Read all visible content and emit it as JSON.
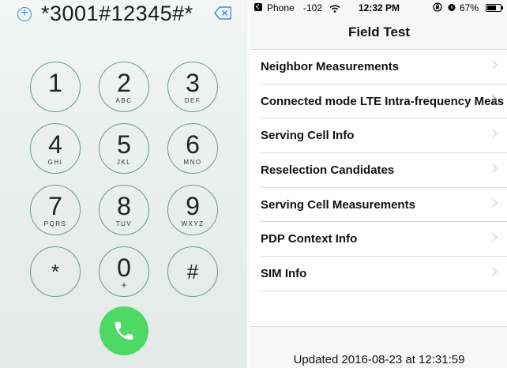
{
  "dialer": {
    "dialed_number": "*3001#12345#*",
    "keys": [
      {
        "digit": "1",
        "letters": ""
      },
      {
        "digit": "2",
        "letters": "ABC"
      },
      {
        "digit": "3",
        "letters": "DEF"
      },
      {
        "digit": "4",
        "letters": "GHI"
      },
      {
        "digit": "5",
        "letters": "JKL"
      },
      {
        "digit": "6",
        "letters": "MNO"
      },
      {
        "digit": "7",
        "letters": "PQRS"
      },
      {
        "digit": "8",
        "letters": "TUV"
      },
      {
        "digit": "9",
        "letters": "WXYZ"
      },
      {
        "digit": "*",
        "letters": ""
      },
      {
        "digit": "0",
        "letters": "+"
      },
      {
        "digit": "#",
        "letters": ""
      }
    ],
    "icons": {
      "add": "add-contact-icon",
      "delete": "delete-icon",
      "call": "phone-icon"
    },
    "colors": {
      "accent": "#3b8cf0",
      "call": "#4cd964",
      "key_ring": "#6b9a87"
    }
  },
  "status_bar": {
    "back_label": "Phone",
    "signal": "-102",
    "time": "12:32 PM",
    "battery_pct": "67%",
    "battery_level": 0.67
  },
  "field_test": {
    "title": "Field Test",
    "items": [
      {
        "label": "Neighbor Measurements"
      },
      {
        "label": "Connected mode LTE Intra-frequency Meas"
      },
      {
        "label": "Serving Cell Info"
      },
      {
        "label": "Reselection Candidates"
      },
      {
        "label": "Serving Cell Measurements"
      },
      {
        "label": "PDP Context Info"
      },
      {
        "label": "SIM Info"
      }
    ],
    "footer": "Updated 2016-08-23 at 12:31:59"
  }
}
